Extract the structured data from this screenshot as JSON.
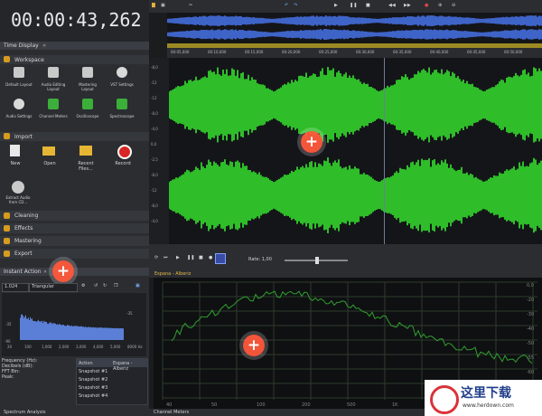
{
  "time_display": {
    "value": "00:00:43,262",
    "panel_title": "Time Display"
  },
  "workspace": {
    "section_title": "Workspace",
    "items": [
      {
        "label": "Default Layout",
        "icon": "layout-icon"
      },
      {
        "label": "Audio Editing Layout",
        "icon": "layout-icon"
      },
      {
        "label": "Mastering Layout",
        "icon": "layout-icon"
      },
      {
        "label": "VST Settings",
        "icon": "gear-icon"
      },
      {
        "label": "Audio Settings",
        "icon": "gear-icon"
      },
      {
        "label": "Channel Meters",
        "icon": "meter-icon"
      },
      {
        "label": "Oscilloscope",
        "icon": "scope-icon"
      },
      {
        "label": "Spectroscope",
        "icon": "spectro-icon"
      }
    ]
  },
  "import": {
    "section_title": "Import",
    "items": [
      {
        "label": "New"
      },
      {
        "label": "Open"
      },
      {
        "label": "Recent Files..."
      },
      {
        "label": "Record"
      },
      {
        "label": "Extract Audio from CD..."
      }
    ]
  },
  "sections": [
    "Cleaning",
    "Effects",
    "Mastering",
    "Export"
  ],
  "instant_action": {
    "title": "Instant Action",
    "fft_select": "1.024",
    "window_select": "Triangular"
  },
  "analysis": {
    "labels": [
      "Frequency (Hz):",
      "Decibels (dB):",
      "FFT Bin:",
      "Peak:"
    ],
    "axis": [
      "20",
      "100",
      "1,000",
      "2,000",
      "3,000",
      "4,000",
      "5,000",
      "8000 Hz"
    ],
    "db_label": "-35",
    "db_low": "-90"
  },
  "history": {
    "columns": [
      "Action",
      "File"
    ],
    "rows": [
      [
        "Action",
        "Espana - Alberiz"
      ],
      [
        "Snapshot #1",
        ""
      ],
      [
        "Snapshot #2",
        ""
      ],
      [
        "Snapshot #3",
        ""
      ],
      [
        "Snapshot #4",
        ""
      ]
    ]
  },
  "bottom_tabs": [
    "Spectrum Analysis",
    "Channel Meters"
  ],
  "wave": {
    "ruler": [
      "00:05,000",
      "00:10,000",
      "00:15,000",
      "00:20,000",
      "00:25,000",
      "00:30,000",
      "00:35,000",
      "00:40,000",
      "00:45,000",
      "00:50,000"
    ],
    "db_ticks": [
      "-8,0",
      "-12",
      "-12",
      "-8,0",
      "-4,0",
      "0,0",
      "-2,5",
      "-8,0",
      "-12",
      "-8,0",
      "-4,0"
    ],
    "rate_label": "Rate: 1,00"
  },
  "spectro_tab": "Espana - Alberiz",
  "spectro_axis": [
    "0,0",
    "-20",
    "-30",
    "-40",
    "-50",
    "-55",
    "-60",
    "-70"
  ],
  "spectro_freq": [
    "40",
    "50",
    "100",
    "200",
    "500",
    "1K",
    "2K",
    "5K"
  ],
  "watermark": {
    "text": "这里下载",
    "sub": "www.herdown.com"
  },
  "colors": {
    "wave_green": "#2fbd2a",
    "accent_orange": "#f05a3c",
    "overview_blue": "#3f64c8"
  }
}
